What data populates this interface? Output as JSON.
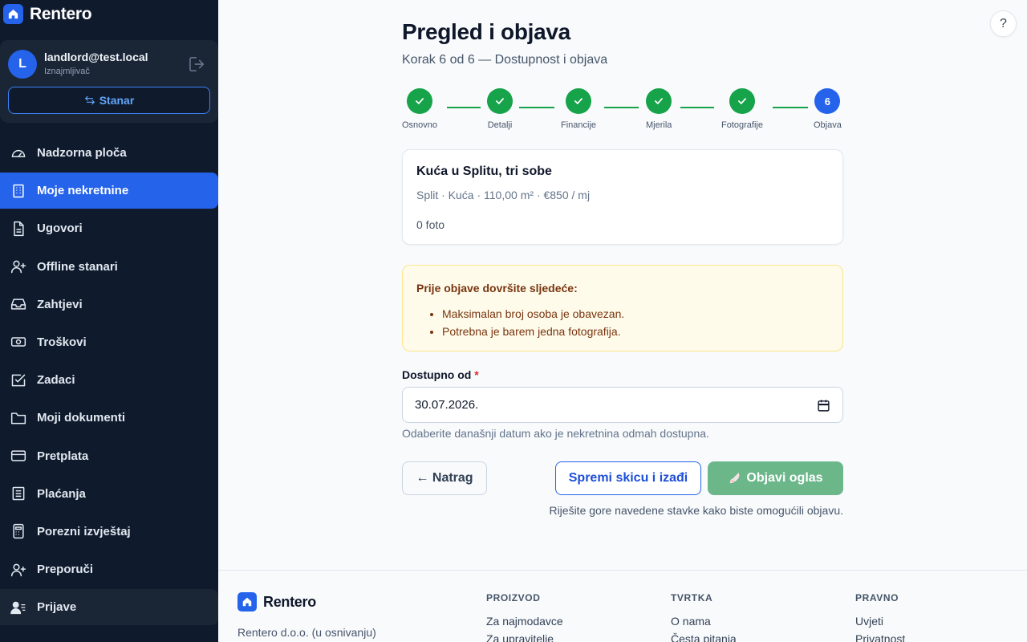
{
  "app": {
    "name": "Rentero"
  },
  "user": {
    "initial": "L",
    "email": "landlord@test.local",
    "role": "Iznajmljivač",
    "switch_label": "Stanar"
  },
  "nav": [
    {
      "label": "Nadzorna ploča",
      "icon": "dashboard-icon"
    },
    {
      "label": "Moje nekretnine",
      "icon": "building-icon",
      "active": true
    },
    {
      "label": "Ugovori",
      "icon": "document-icon"
    },
    {
      "label": "Offline stanari",
      "icon": "user-plus-icon"
    },
    {
      "label": "Zahtjevi",
      "icon": "inbox-icon"
    },
    {
      "label": "Troškovi",
      "icon": "banknote-icon"
    },
    {
      "label": "Zadaci",
      "icon": "checkbox-icon"
    },
    {
      "label": "Moji dokumenti",
      "icon": "folder-icon"
    },
    {
      "label": "Pretplata",
      "icon": "credit-card-icon"
    },
    {
      "label": "Plaćanja",
      "icon": "receipt-icon"
    },
    {
      "label": "Porezni izvještaj",
      "icon": "calculator-icon"
    },
    {
      "label": "Preporuči",
      "icon": "user-plus-icon"
    },
    {
      "label": "Prijave",
      "icon": "user-list-icon"
    }
  ],
  "help_label": "?",
  "page": {
    "title": "Pregled i objava",
    "subtitle": "Korak 6 od 6 — Dostupnost i objava"
  },
  "steps": [
    {
      "label": "Osnovno",
      "done": true
    },
    {
      "label": "Detalji",
      "done": true
    },
    {
      "label": "Financije",
      "done": true
    },
    {
      "label": "Mjerila",
      "done": true
    },
    {
      "label": "Fotografije",
      "done": true
    },
    {
      "label": "Objava",
      "number": "6",
      "current": true
    }
  ],
  "summary": {
    "title": "Kuća u Splitu, tri sobe",
    "meta": "Split · Kuća · 110,00 m² · €850 / mj",
    "photos": "0 foto"
  },
  "warning": {
    "title": "Prije objave dovršite sljedeće:",
    "items": [
      "Maksimalan broj osoba je obavezan.",
      "Potrebna je barem jedna fotografija."
    ]
  },
  "availability": {
    "label": "Dostupno od",
    "required_mark": "*",
    "value": "30.07.2026.",
    "hint": "Odaberite današnji datum ako je nekretnina odmah dostupna."
  },
  "actions": {
    "back": "← Natrag",
    "draft": "Spremi skicu i izađi",
    "publish": "Objavi oglas",
    "publish_hint": "Riješite gore navedene stavke kako biste omogućili objavu."
  },
  "footer": {
    "brand": "Rentero",
    "company": "Rentero d.o.o. (u osnivanju)",
    "columns": [
      {
        "title": "PROIZVOD",
        "links": [
          "Za najmodavce",
          "Za upravitelje"
        ]
      },
      {
        "title": "TVRTKA",
        "links": [
          "O nama",
          "Česta pitanja"
        ]
      },
      {
        "title": "PRAVNO",
        "links": [
          "Uvjeti",
          "Privatnost"
        ]
      }
    ]
  },
  "colors": {
    "primary": "#2563eb",
    "sidebar": "#0f1b2d",
    "success": "#16a34a",
    "warning_bg": "#fffbeb",
    "publish_disabled": "#6cb78a"
  }
}
